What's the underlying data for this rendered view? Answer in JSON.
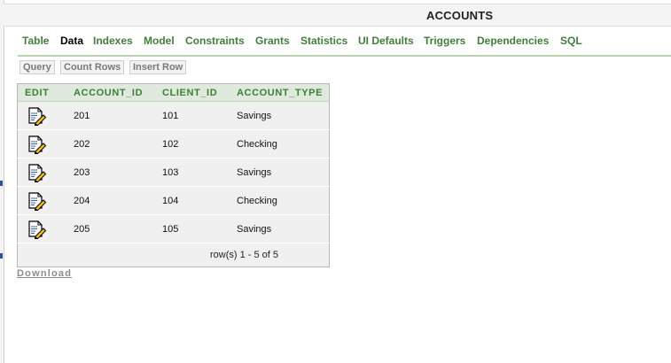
{
  "header": {
    "title": "ACCOUNTS"
  },
  "tabs": [
    {
      "label": "Table",
      "active": false
    },
    {
      "label": "Data",
      "active": true
    },
    {
      "label": "Indexes",
      "active": false
    },
    {
      "label": "Model",
      "active": false
    },
    {
      "label": "Constraints",
      "active": false
    },
    {
      "label": "Grants",
      "active": false
    },
    {
      "label": "Statistics",
      "active": false
    },
    {
      "label": "UI Defaults",
      "active": false
    },
    {
      "label": "Triggers",
      "active": false
    },
    {
      "label": "Dependencies",
      "active": false
    },
    {
      "label": "SQL",
      "active": false
    }
  ],
  "toolbar": {
    "query_label": "Query",
    "count_rows_label": "Count Rows",
    "insert_row_label": "Insert Row"
  },
  "table": {
    "columns": [
      "EDIT",
      "ACCOUNT_ID",
      "CLIENT_ID",
      "ACCOUNT_TYPE"
    ],
    "rows": [
      {
        "edit_icon": "edit-document-pencil-icon",
        "account_id": "201",
        "client_id": "101",
        "account_type": "Savings"
      },
      {
        "edit_icon": "edit-document-pencil-icon",
        "account_id": "202",
        "client_id": "102",
        "account_type": "Checking"
      },
      {
        "edit_icon": "edit-document-pencil-icon",
        "account_id": "203",
        "client_id": "103",
        "account_type": "Savings"
      },
      {
        "edit_icon": "edit-document-pencil-icon",
        "account_id": "204",
        "client_id": "104",
        "account_type": "Checking"
      },
      {
        "edit_icon": "edit-document-pencil-icon",
        "account_id": "205",
        "client_id": "105",
        "account_type": "Savings"
      }
    ],
    "footer": "row(s) 1 - 5 of 5"
  },
  "download_label": "Download",
  "colors": {
    "tab_green": "#3f7f3a",
    "header_bg": "#dfe9dc",
    "row_bg": "#f0f0f0"
  }
}
